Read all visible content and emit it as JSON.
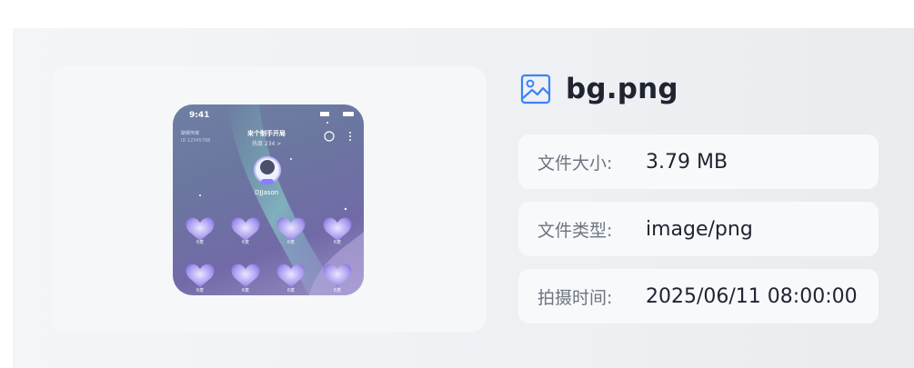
{
  "file": {
    "name": "bg.png",
    "icon": "image-file-icon",
    "accent": "#3b82f6"
  },
  "details": [
    {
      "label": "文件大小:",
      "value": "3.79 MB"
    },
    {
      "label": "文件类型:",
      "value": "image/png"
    },
    {
      "label": "拍摄时间:",
      "value": "2025/06/11 08:00:00"
    }
  ],
  "preview": {
    "status_time": "9:41",
    "room_title": "来个制手开局",
    "room_sub": "热度 234 >",
    "left_line1": "聊娱传媒",
    "left_line2": "ID 12345768",
    "host_name": "DJJason",
    "seat_label": "6麦",
    "seats": 8
  }
}
